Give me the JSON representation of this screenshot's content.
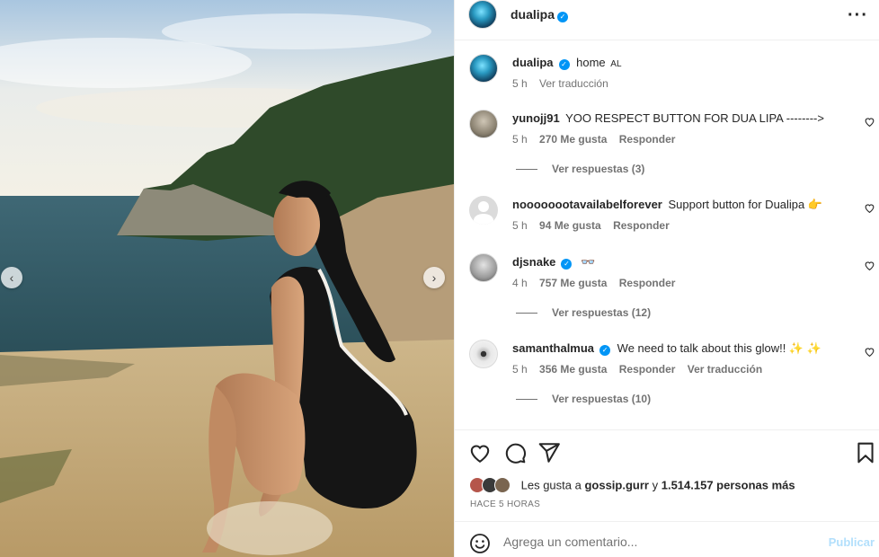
{
  "post": {
    "author": "dualipa",
    "caption_text": "home",
    "caption_flag": "AL",
    "caption_time": "5 h",
    "caption_translate": "Ver traducción"
  },
  "comments": [
    {
      "user": "yunojj91",
      "text": "YOO RESPECT BUTTON FOR DUA LIPA -------->",
      "time": "5 h",
      "likes": "270 Me gusta",
      "reply": "Responder",
      "view_replies": "Ver respuestas (3)"
    },
    {
      "user": "noooooootavailabelforever",
      "text": "Support button for Dualipa 👉",
      "time": "5 h",
      "likes": "94 Me gusta",
      "reply": "Responder"
    },
    {
      "user": "djsnake",
      "text": "👓",
      "time": "4 h",
      "likes": "757 Me gusta",
      "reply": "Responder",
      "view_replies": "Ver respuestas (12)"
    },
    {
      "user": "samanthalmua",
      "text": "We need to talk about this glow!! ✨ ✨",
      "time": "5 h",
      "likes": "356 Me gusta",
      "reply": "Responder",
      "translate": "Ver traducción",
      "view_replies": "Ver respuestas (10)"
    }
  ],
  "likes_summary": {
    "prefix": "Les gusta a",
    "user": "gossip.gurr",
    "joiner": "y",
    "count": "1.514.157 personas más"
  },
  "time_ago": "HACE 5 HORAS",
  "comment_box": {
    "placeholder": "Agrega un comentario...",
    "publish": "Publicar"
  },
  "icons": {
    "more": "more-icon",
    "heart": "heart-icon",
    "comment": "comment-icon",
    "share": "share-icon",
    "save": "bookmark-icon",
    "emoji": "emoji-icon",
    "verified": "verified-icon",
    "prev": "chevron-left-icon",
    "next": "chevron-right-icon"
  },
  "colors": {
    "verified": "#0095f6",
    "publish_disabled": "#b2dffc",
    "meta": "#737373"
  }
}
